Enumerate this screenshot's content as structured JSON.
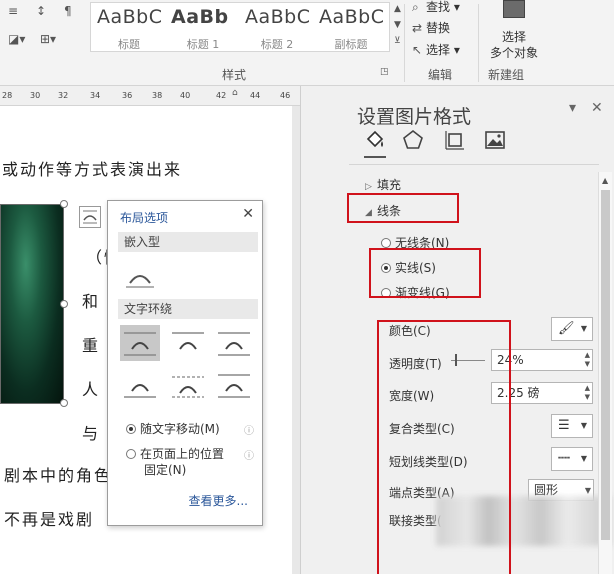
{
  "ribbon": {
    "styles": [
      {
        "sample": "AaBbC",
        "label": "标题",
        "bold": false
      },
      {
        "sample": "AaBb",
        "label": "标题 1",
        "bold": true
      },
      {
        "sample": "AaBbC",
        "label": "标题 2",
        "bold": false
      },
      {
        "sample": "AaBbC",
        "label": "副标题",
        "bold": false
      }
    ],
    "styles_group_label": "样式",
    "edit": {
      "find": "查找",
      "replace": "替换",
      "select": "选择"
    },
    "edit_group_label": "编辑",
    "select_multi_line1": "选择",
    "select_multi_line2": "多个对象",
    "new_group_label": "新建组"
  },
  "ruler": {
    "numbers": [
      "28",
      "30",
      "32",
      "34",
      "36",
      "38",
      "40",
      "42",
      "44",
      "46"
    ]
  },
  "document": {
    "lines": [
      "或动作等方式表演出来",
      "（情节）",
      "和",
      "重",
      "人",
      "与",
      "剧本中的角色",
      "不再是戏剧"
    ]
  },
  "layout_popup": {
    "title": "布局选项",
    "inline_header": "嵌入型",
    "wrap_header": "文字环绕",
    "move_with_text": "随文字移动(M)",
    "fix_position_line1": "在页面上的位置",
    "fix_position_line2": "固定(N)",
    "see_more": "查看更多..."
  },
  "format_pane": {
    "title": "设置图片格式",
    "fill_label": "填充",
    "line_label": "线条",
    "line_options": [
      "无线条(N)",
      "实线(S)",
      "渐变线(G)"
    ],
    "selected_line_option": "实线(S)",
    "props": {
      "color": "颜色(C)",
      "transparency": "透明度(T)",
      "transparency_value": "24%",
      "width": "宽度(W)",
      "width_value": "2.25 磅",
      "compound": "复合类型(C)",
      "dash": "短划线类型(D)",
      "cap": "端点类型(A)",
      "cap_value": "圆形",
      "join": "联接类型("
    }
  },
  "colors": {
    "accent": "#2b579a",
    "annotation": "#d0121b"
  }
}
